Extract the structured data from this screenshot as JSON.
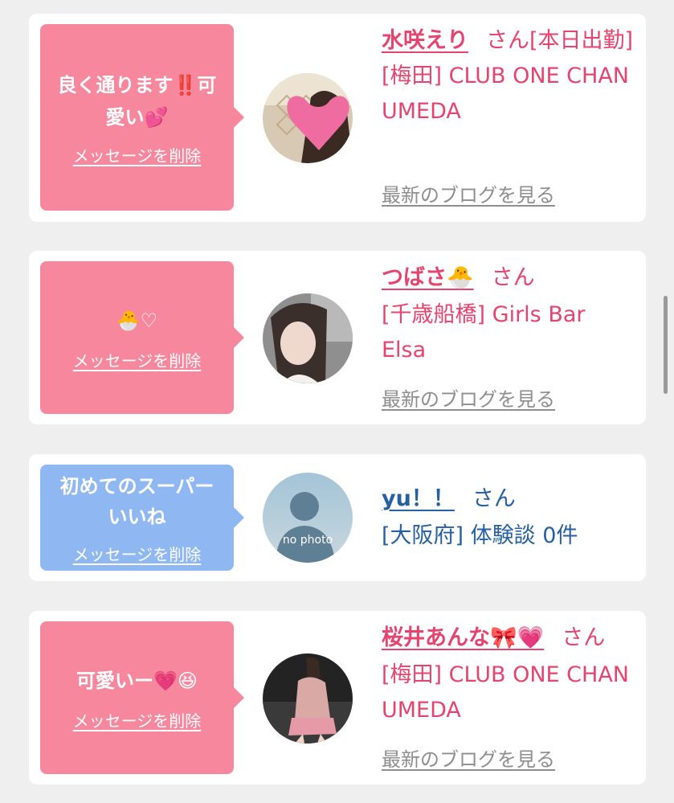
{
  "common": {
    "delete_label": "メッセージを削除",
    "san": "さん",
    "blog_label": "最新のブログを見る"
  },
  "cards": [
    {
      "message_line1": "良く通ります‼️可",
      "message_line2": "愛い💕",
      "name": "水咲えり",
      "name_suffix": "さん[本日出勤]",
      "shop": "[梅田] CLUB ONE CHAN UMEDA",
      "bubble_color": "#f7879d"
    },
    {
      "message_line1": "🐣♡",
      "name": "つばさ🐣",
      "shop": "[千歳船橋] Girls Bar Elsa",
      "bubble_color": "#f7879d"
    },
    {
      "message_line1": "初めてのスーパー",
      "message_line2": "いいね",
      "name": "yu！！",
      "shop": "[大阪府] 体験談 0件",
      "avatar_text": "no photo",
      "bubble_color": "#8fb8f3"
    },
    {
      "message_line1": "可愛いー💗😆",
      "name": "桜井あんな🎀💗",
      "shop": "[梅田] CLUB ONE CHAN UMEDA",
      "bubble_color": "#f7879d"
    }
  ],
  "colors": {
    "pink_text": "#e6436e",
    "blue_text": "#255fa4",
    "link_gray": "#8e8e8e",
    "background": "#efefef"
  }
}
